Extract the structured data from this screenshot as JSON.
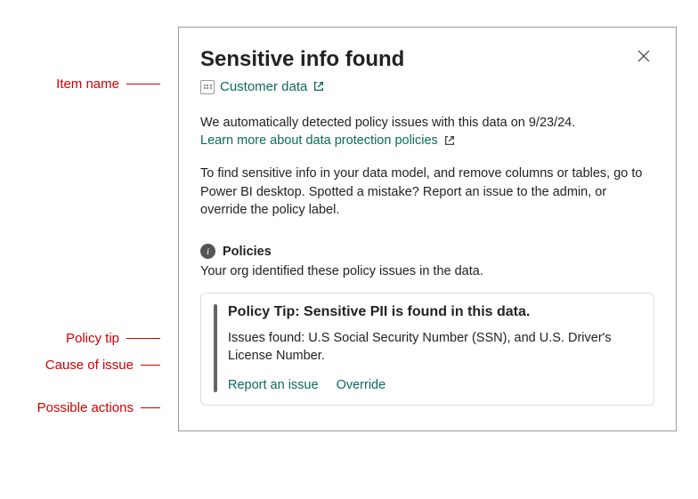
{
  "annotations": {
    "item_name": "Item name",
    "policy_tip": "Policy tip",
    "cause_of_issue": "Cause of issue",
    "possible_actions": "Possible actions"
  },
  "dialog": {
    "title": "Sensitive info found",
    "item_name": "Customer data",
    "detected_text": "We automatically detected policy issues with this data on 9/23/24.",
    "learn_link": "Learn more about data protection policies",
    "instructions": "To find sensitive info in your data model, and remove columns or tables, go to Power BI desktop. Spotted a mistake? Report an issue to the admin, or override the policy label.",
    "policies_label": "Policies",
    "policies_desc": "Your org identified these policy issues in the data.",
    "policy_card": {
      "tip_title": "Policy Tip: Sensitive PII is found in this data.",
      "issues": "Issues found: U.S Social Security Number (SSN), and U.S. Driver's License Number.",
      "report_label": "Report an issue",
      "override_label": "Override"
    }
  }
}
